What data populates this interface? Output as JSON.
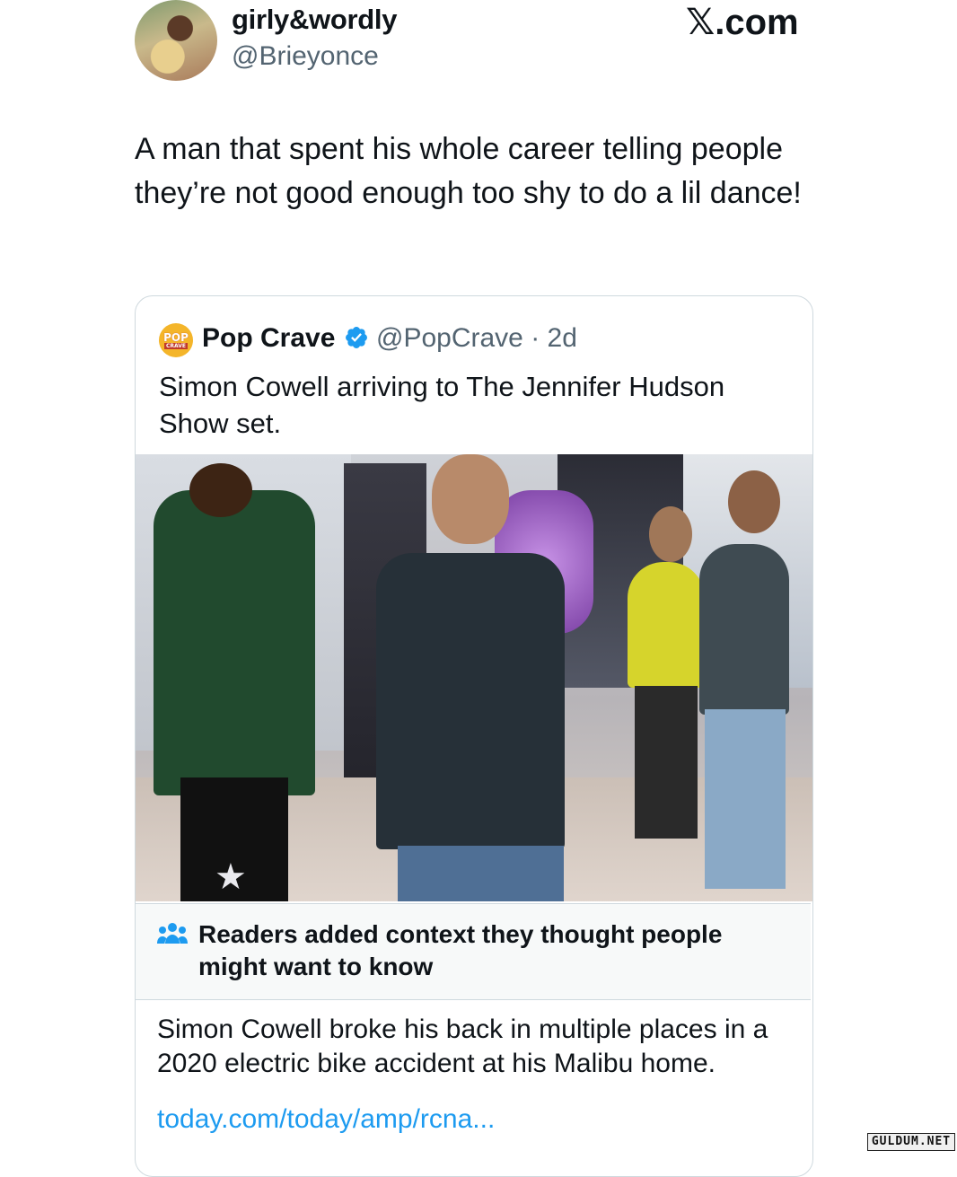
{
  "author": {
    "name": "girly&wordly",
    "handle": "@Brieyonce"
  },
  "site": {
    "x_glyph": "𝕏",
    "suffix": ".com"
  },
  "tweet": {
    "text": "A man that spent his whole career telling people they’re not good enough too shy to do a lil dance!"
  },
  "quoted": {
    "logo_top": "POP",
    "logo_bottom": "CRAVE",
    "name": "Pop Crave",
    "handle_time": "@PopCrave · 2d",
    "text": "Simon Cowell arriving to The Jennifer Hudson Show set."
  },
  "community_note": {
    "title": "Readers added context they thought people might want to know",
    "body": "Simon Cowell broke his back in multiple places in a 2020 electric bike accident at his Malibu home.",
    "link": "today.com/today/amp/rcna..."
  },
  "watermark": {
    "text": "GULDUM.NET"
  },
  "colors": {
    "text_primary": "#0f1419",
    "text_secondary": "#536471",
    "link": "#1d9bf0",
    "verified": "#1d9bf0",
    "note_bg": "#f7f9f9",
    "border": "#cfd9de"
  }
}
